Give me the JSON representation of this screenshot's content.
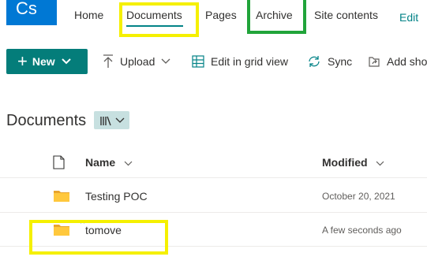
{
  "logo": {
    "initials": "Cs"
  },
  "nav": {
    "items": [
      "Home",
      "Documents",
      "Pages",
      "Archive",
      "Site contents"
    ],
    "edit": "Edit"
  },
  "commands": {
    "new": "New",
    "upload": "Upload",
    "grid": "Edit in grid view",
    "sync": "Sync",
    "add_shortcut": "Add sho"
  },
  "library": {
    "title": "Documents"
  },
  "table": {
    "columns": [
      "Name",
      "Modified"
    ],
    "rows": [
      {
        "name": "Testing POC",
        "modified": "October 20, 2021"
      },
      {
        "name": "tomove",
        "modified": "A few seconds ago"
      }
    ]
  },
  "colors": {
    "brand": "#0078d4",
    "accent": "#038387",
    "new_button": "#047d7a",
    "folder": "#ffc83d",
    "highlight_yellow": "#f5f000",
    "highlight_green": "#21a43a"
  }
}
